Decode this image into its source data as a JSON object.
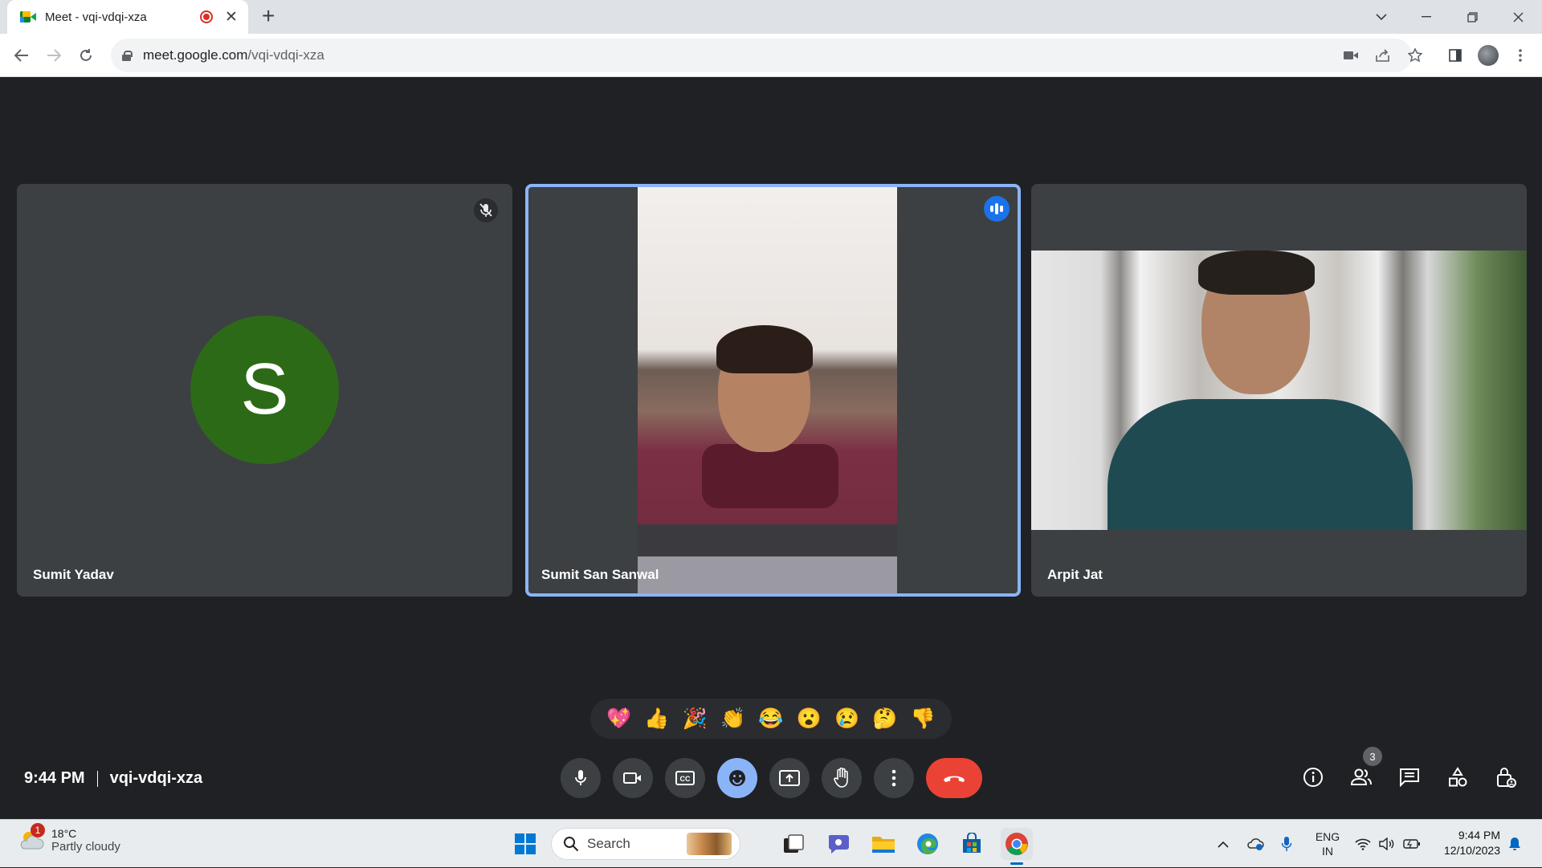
{
  "browser": {
    "tab_title": "Meet - vqi-vdqi-xza",
    "url_host": "meet.google.com",
    "url_path": "/vqi-vdqi-xza"
  },
  "participants": [
    {
      "name": "Sumit Yadav",
      "initial": "S",
      "avatar_color": "#2d6a18",
      "muted": true
    },
    {
      "name": "Sumit San Sanwal",
      "speaking": true
    },
    {
      "name": "Arpit Jat"
    }
  ],
  "reactions": [
    "💖",
    "👍",
    "🎉",
    "👏",
    "😂",
    "😮",
    "😢",
    "🤔",
    "👎"
  ],
  "meeting": {
    "time": "9:44 PM",
    "code": "vqi-vdqi-xza",
    "participant_count": "3"
  },
  "taskbar": {
    "weather_badge": "1",
    "temperature": "18°C",
    "weather_desc": "Partly cloudy",
    "search_label": "Search",
    "lang_line1": "ENG",
    "lang_line2": "IN",
    "clock_time": "9:44 PM",
    "clock_date": "12/10/2023"
  },
  "colors": {
    "meet_background": "#202124",
    "tile_background": "#3c4043",
    "active_speaker_border": "#8ab4f8",
    "end_call": "#ea4335",
    "reaction_active": "#8ab4f8"
  }
}
